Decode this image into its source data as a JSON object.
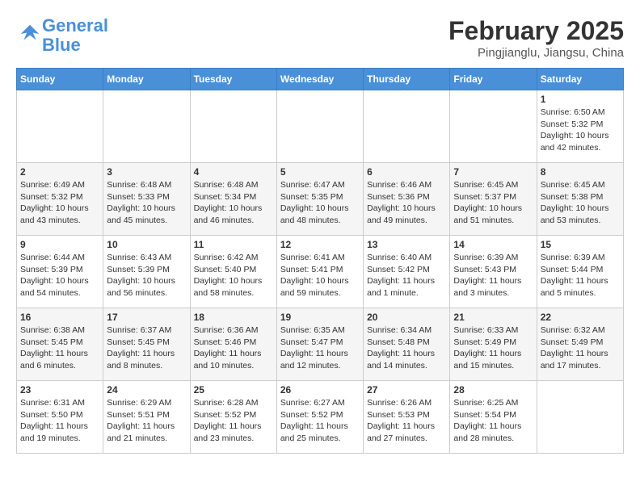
{
  "header": {
    "logo_line1": "General",
    "logo_line2": "Blue",
    "month": "February 2025",
    "location": "Pingjianglu, Jiangsu, China"
  },
  "weekdays": [
    "Sunday",
    "Monday",
    "Tuesday",
    "Wednesday",
    "Thursday",
    "Friday",
    "Saturday"
  ],
  "weeks": [
    [
      {
        "day": "",
        "info": ""
      },
      {
        "day": "",
        "info": ""
      },
      {
        "day": "",
        "info": ""
      },
      {
        "day": "",
        "info": ""
      },
      {
        "day": "",
        "info": ""
      },
      {
        "day": "",
        "info": ""
      },
      {
        "day": "1",
        "info": "Sunrise: 6:50 AM\nSunset: 5:32 PM\nDaylight: 10 hours and 42 minutes."
      }
    ],
    [
      {
        "day": "2",
        "info": "Sunrise: 6:49 AM\nSunset: 5:32 PM\nDaylight: 10 hours and 43 minutes."
      },
      {
        "day": "3",
        "info": "Sunrise: 6:48 AM\nSunset: 5:33 PM\nDaylight: 10 hours and 45 minutes."
      },
      {
        "day": "4",
        "info": "Sunrise: 6:48 AM\nSunset: 5:34 PM\nDaylight: 10 hours and 46 minutes."
      },
      {
        "day": "5",
        "info": "Sunrise: 6:47 AM\nSunset: 5:35 PM\nDaylight: 10 hours and 48 minutes."
      },
      {
        "day": "6",
        "info": "Sunrise: 6:46 AM\nSunset: 5:36 PM\nDaylight: 10 hours and 49 minutes."
      },
      {
        "day": "7",
        "info": "Sunrise: 6:45 AM\nSunset: 5:37 PM\nDaylight: 10 hours and 51 minutes."
      },
      {
        "day": "8",
        "info": "Sunrise: 6:45 AM\nSunset: 5:38 PM\nDaylight: 10 hours and 53 minutes."
      }
    ],
    [
      {
        "day": "9",
        "info": "Sunrise: 6:44 AM\nSunset: 5:39 PM\nDaylight: 10 hours and 54 minutes."
      },
      {
        "day": "10",
        "info": "Sunrise: 6:43 AM\nSunset: 5:39 PM\nDaylight: 10 hours and 56 minutes."
      },
      {
        "day": "11",
        "info": "Sunrise: 6:42 AM\nSunset: 5:40 PM\nDaylight: 10 hours and 58 minutes."
      },
      {
        "day": "12",
        "info": "Sunrise: 6:41 AM\nSunset: 5:41 PM\nDaylight: 10 hours and 59 minutes."
      },
      {
        "day": "13",
        "info": "Sunrise: 6:40 AM\nSunset: 5:42 PM\nDaylight: 11 hours and 1 minute."
      },
      {
        "day": "14",
        "info": "Sunrise: 6:39 AM\nSunset: 5:43 PM\nDaylight: 11 hours and 3 minutes."
      },
      {
        "day": "15",
        "info": "Sunrise: 6:39 AM\nSunset: 5:44 PM\nDaylight: 11 hours and 5 minutes."
      }
    ],
    [
      {
        "day": "16",
        "info": "Sunrise: 6:38 AM\nSunset: 5:45 PM\nDaylight: 11 hours and 6 minutes."
      },
      {
        "day": "17",
        "info": "Sunrise: 6:37 AM\nSunset: 5:45 PM\nDaylight: 11 hours and 8 minutes."
      },
      {
        "day": "18",
        "info": "Sunrise: 6:36 AM\nSunset: 5:46 PM\nDaylight: 11 hours and 10 minutes."
      },
      {
        "day": "19",
        "info": "Sunrise: 6:35 AM\nSunset: 5:47 PM\nDaylight: 11 hours and 12 minutes."
      },
      {
        "day": "20",
        "info": "Sunrise: 6:34 AM\nSunset: 5:48 PM\nDaylight: 11 hours and 14 minutes."
      },
      {
        "day": "21",
        "info": "Sunrise: 6:33 AM\nSunset: 5:49 PM\nDaylight: 11 hours and 15 minutes."
      },
      {
        "day": "22",
        "info": "Sunrise: 6:32 AM\nSunset: 5:49 PM\nDaylight: 11 hours and 17 minutes."
      }
    ],
    [
      {
        "day": "23",
        "info": "Sunrise: 6:31 AM\nSunset: 5:50 PM\nDaylight: 11 hours and 19 minutes."
      },
      {
        "day": "24",
        "info": "Sunrise: 6:29 AM\nSunset: 5:51 PM\nDaylight: 11 hours and 21 minutes."
      },
      {
        "day": "25",
        "info": "Sunrise: 6:28 AM\nSunset: 5:52 PM\nDaylight: 11 hours and 23 minutes."
      },
      {
        "day": "26",
        "info": "Sunrise: 6:27 AM\nSunset: 5:52 PM\nDaylight: 11 hours and 25 minutes."
      },
      {
        "day": "27",
        "info": "Sunrise: 6:26 AM\nSunset: 5:53 PM\nDaylight: 11 hours and 27 minutes."
      },
      {
        "day": "28",
        "info": "Sunrise: 6:25 AM\nSunset: 5:54 PM\nDaylight: 11 hours and 28 minutes."
      },
      {
        "day": "",
        "info": ""
      }
    ]
  ]
}
